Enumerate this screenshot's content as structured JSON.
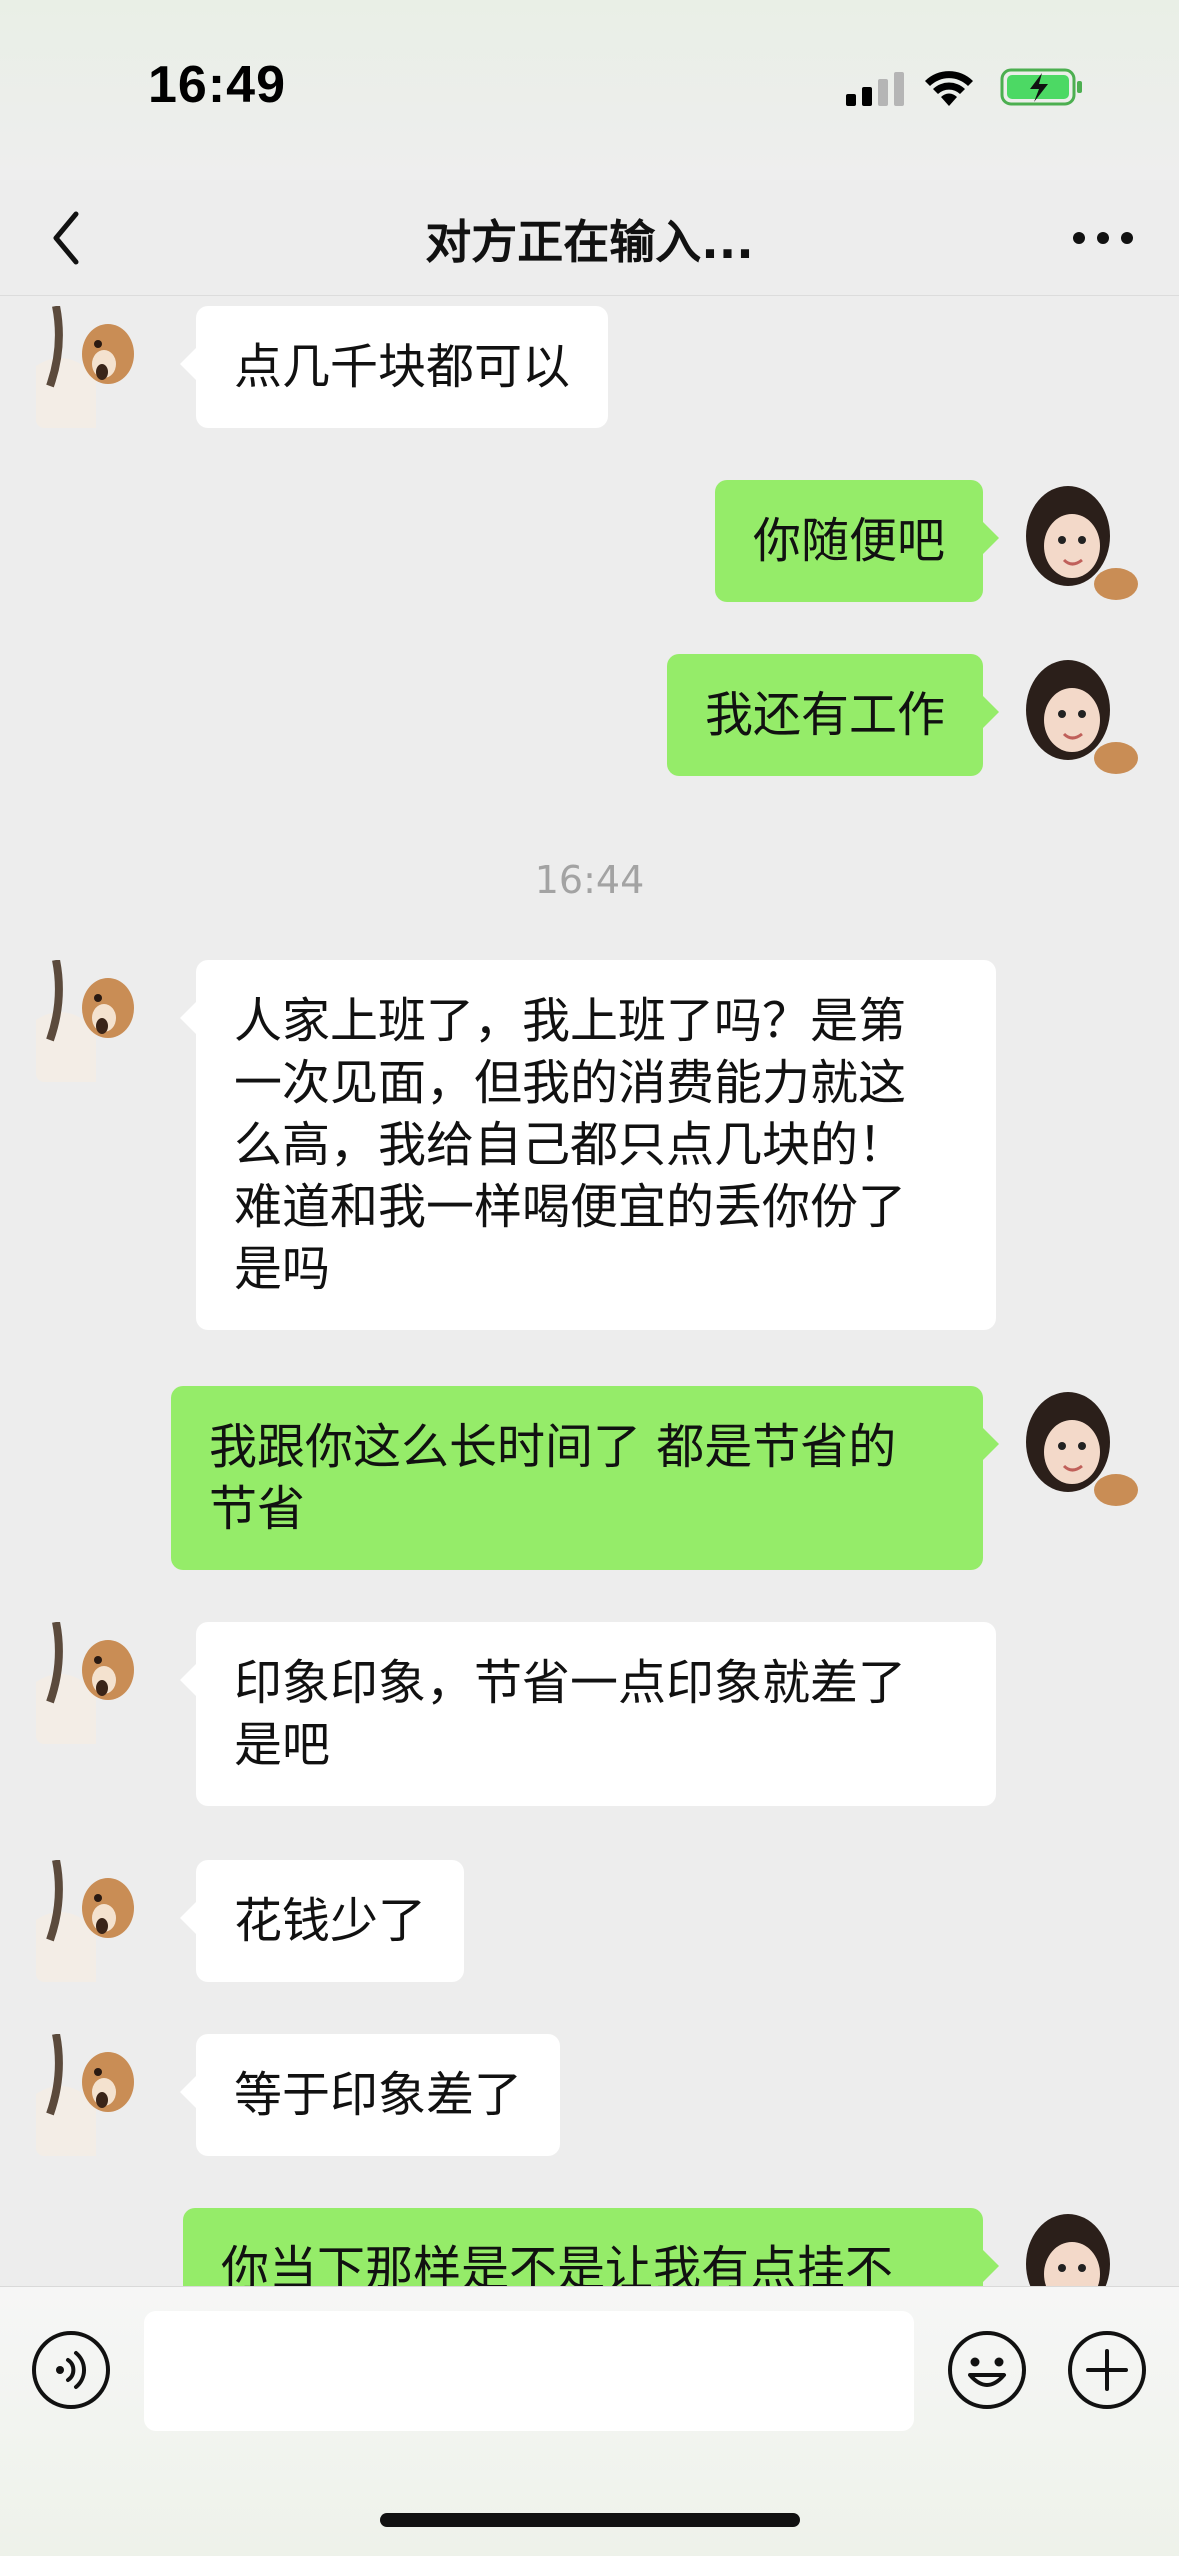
{
  "status_bar": {
    "time": "16:49"
  },
  "nav": {
    "title": "对方正在输入..."
  },
  "chat": {
    "timestamp": "16:44",
    "messages": [
      {
        "side": "left",
        "text": "点几千块都可以"
      },
      {
        "side": "right",
        "text": "你随便吧"
      },
      {
        "side": "right",
        "text": "我还有工作"
      },
      {
        "side": "left",
        "lines": [
          "人家上班了，我上班了吗？是第",
          "一次见面，但我的消费能力就这",
          "么高，我给自己都只点几块的！",
          "难道和我一样喝便宜的丢你份了",
          "是吗"
        ]
      },
      {
        "side": "right",
        "lines": [
          "我跟你这么长时间了 都是节省的",
          "节省"
        ]
      },
      {
        "side": "left",
        "lines": [
          "印象印象，节省一点印象就差了",
          "是吧"
        ]
      },
      {
        "side": "left",
        "text": "花钱少了"
      },
      {
        "side": "left",
        "text": "等于印象差了"
      },
      {
        "side": "right",
        "text": "你当下那样是不是让我有点挂不"
      }
    ]
  },
  "input": {
    "value": ""
  },
  "colors": {
    "sent_bubble": "#95ec69",
    "received_bubble": "#ffffff",
    "background": "#ededed"
  }
}
